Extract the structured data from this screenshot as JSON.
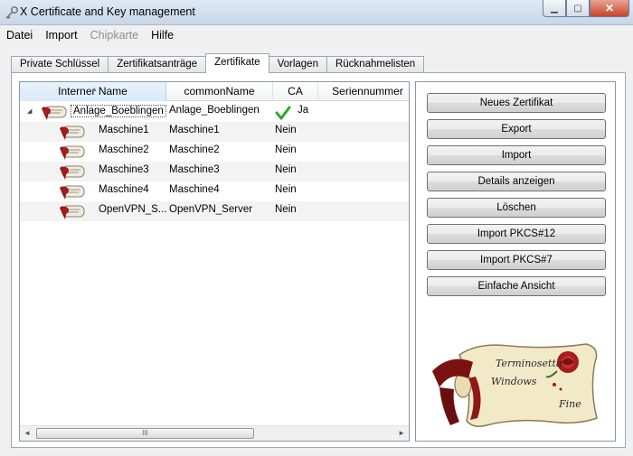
{
  "window": {
    "title": "X Certificate and Key management",
    "minimize": "▁",
    "maximize": "▢",
    "close": "✕"
  },
  "menu": [
    {
      "label": "Datei",
      "enabled": true
    },
    {
      "label": "Import",
      "enabled": true
    },
    {
      "label": "Chipkarte",
      "enabled": false
    },
    {
      "label": "Hilfe",
      "enabled": true
    }
  ],
  "tabs": [
    {
      "label": "Private Schlüssel",
      "active": false
    },
    {
      "label": "Zertifikatsanträge",
      "active": false
    },
    {
      "label": "Zertifikate",
      "active": true
    },
    {
      "label": "Vorlagen",
      "active": false
    },
    {
      "label": "Rücknahmelisten",
      "active": false
    }
  ],
  "list": {
    "columns": [
      "Interner Name",
      "commonName",
      "CA",
      "Seriennummer"
    ],
    "rows": [
      {
        "name": "Anlage_Boeblingen",
        "commonName": "Anlage_Boeblingen",
        "ca": "Ja",
        "ca_check": true,
        "root": true
      },
      {
        "name": "Maschine1",
        "commonName": "Maschine1",
        "ca": "Nein"
      },
      {
        "name": "Maschine2",
        "commonName": "Maschine2",
        "ca": "Nein"
      },
      {
        "name": "Maschine3",
        "commonName": "Maschine3",
        "ca": "Nein"
      },
      {
        "name": "Maschine4",
        "commonName": "Maschine4",
        "ca": "Nein"
      },
      {
        "name": "OpenVPN_S...",
        "commonName": "OpenVPN_Server",
        "ca": "Nein"
      }
    ],
    "scroll_left": "◄",
    "scroll_right": "►",
    "scroll_grip": "III"
  },
  "buttons": [
    "Neues Zertifikat",
    "Export",
    "Import",
    "Details anzeigen",
    "Löschen",
    "Import PKCS#12",
    "Import PKCS#7",
    "Einfache Ansicht"
  ],
  "logo": {
    "line1": "Terminosetta",
    "line2": "Windows",
    "line3": "Fine"
  }
}
